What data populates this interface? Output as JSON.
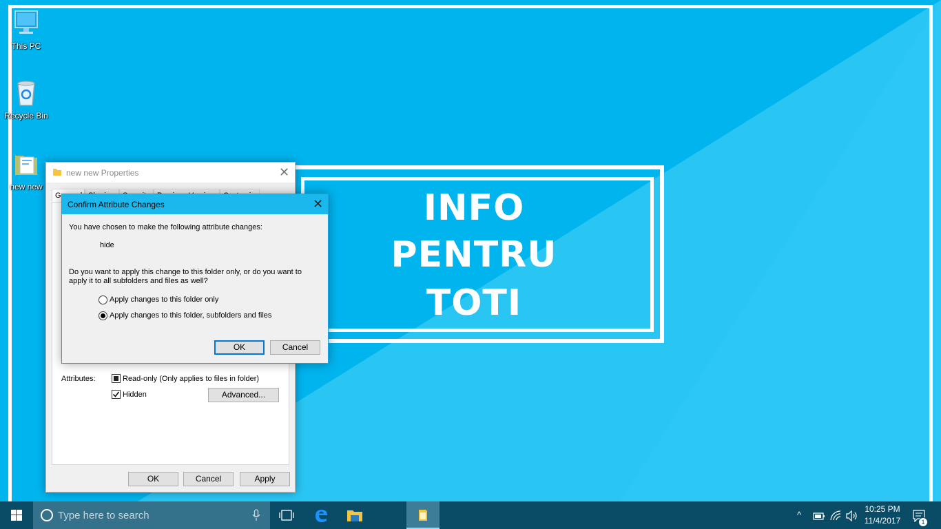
{
  "desktop": {
    "icons": [
      {
        "label": "This PC",
        "icon": "monitor-icon"
      },
      {
        "label": "Recycle Bin",
        "icon": "recycle-bin-icon"
      },
      {
        "label": "new new",
        "icon": "folder-icon"
      }
    ],
    "logo": {
      "line1": "INFO",
      "line2": "PENTRU",
      "line3": "TOTI"
    }
  },
  "properties_dialog": {
    "title": "new new Properties",
    "tabs": [
      "General",
      "Sharing",
      "Security",
      "Previous Versions",
      "Customize"
    ],
    "attributes_label": "Attributes:",
    "readonly_label": "Read-only (Only applies to files in folder)",
    "readonly_state": "indeterminate",
    "hidden_label": "Hidden",
    "hidden_checked": true,
    "advanced_button": "Advanced...",
    "buttons": {
      "ok": "OK",
      "cancel": "Cancel",
      "apply": "Apply"
    }
  },
  "confirm_dialog": {
    "title": "Confirm Attribute Changes",
    "intro": "You have chosen to make the following attribute changes:",
    "change": "hide",
    "question_line1": "Do you want to apply this change to this folder only, or do you want to",
    "question_line2": "apply it to all subfolders and files as well?",
    "option1": "Apply changes to this folder only",
    "option2": "Apply changes to this folder, subfolders and files",
    "selected_option": 2,
    "buttons": {
      "ok": "OK",
      "cancel": "Cancel"
    }
  },
  "taskbar": {
    "search_placeholder": "Type here to search",
    "time": "10:25 PM",
    "date": "11/4/2017",
    "notification_count": "1"
  },
  "colors": {
    "wallpaper": "#00b4ee",
    "wallpaper_light": "#29c5f3",
    "taskbar": "#0a4b66",
    "search_box": "#33728a",
    "accent": "#0078d7",
    "confirm_titlebar": "#1ab8ed"
  }
}
